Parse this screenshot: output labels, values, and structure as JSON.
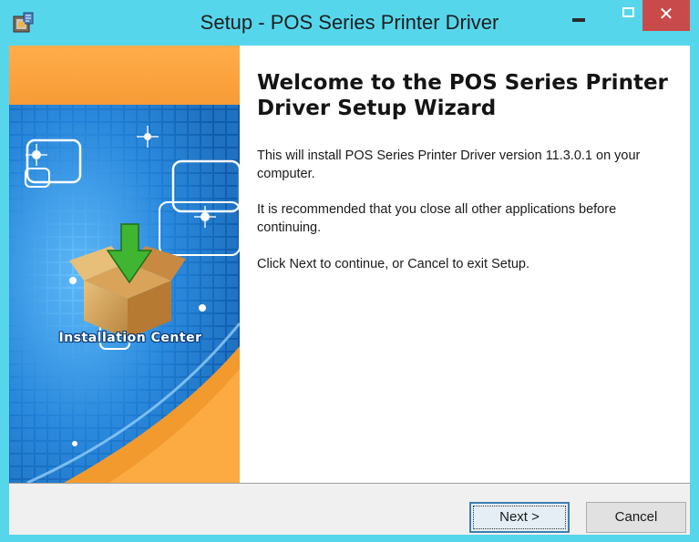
{
  "window": {
    "title": "Setup - POS Series Printer Driver",
    "icon": "setup-installer-icon",
    "controls": [
      "minimize-icon",
      "maximize-icon",
      "close-icon"
    ],
    "close_glyph": "✕",
    "accent_color": "#56d6eb",
    "close_color": "#c94a4a"
  },
  "side_image": {
    "caption": "Installation Center",
    "icon": "package-box-download-icon"
  },
  "wizard": {
    "heading": "Welcome to the POS Series Printer Driver Setup Wizard",
    "paragraphs": [
      "This will install POS Series Printer Driver version 11.3.0.1 on your computer.",
      "It is recommended that you close all other applications before continuing.",
      "Click Next to continue, or Cancel to exit Setup."
    ]
  },
  "buttons": {
    "next_label": "Next >",
    "cancel_label": "Cancel"
  }
}
